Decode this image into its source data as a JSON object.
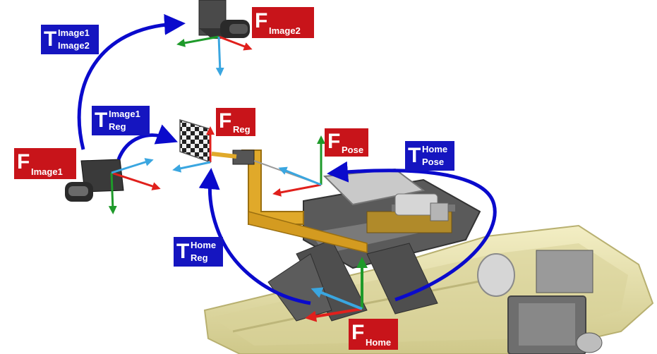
{
  "colors": {
    "frame_label_bg": "#c8141a",
    "transform_label_bg": "#1515c0",
    "axis_x": "#e0201c",
    "axis_y": "#1e9a2a",
    "axis_z": "#3aa6e0",
    "transform_arrow": "#0a0acc",
    "robot_base": "#e9e3a8",
    "robot_arm": "#e0a92a",
    "metal": "#8a8a8a"
  },
  "frames": {
    "image2": {
      "symbol": "F",
      "sub": "Image2"
    },
    "image1": {
      "symbol": "F",
      "sub": "Image1"
    },
    "reg": {
      "symbol": "F",
      "sub": "Reg"
    },
    "pose": {
      "symbol": "F",
      "sub": "Pose"
    },
    "home": {
      "symbol": "F",
      "sub": "Home"
    }
  },
  "transforms": {
    "image1_image2": {
      "symbol": "T",
      "sup": "Image1",
      "sub": "Image2"
    },
    "image1_reg": {
      "symbol": "T",
      "sup": "Image1",
      "sub": "Reg"
    },
    "home_pose": {
      "symbol": "T",
      "sup": "Home",
      "sub": "Pose"
    },
    "home_reg": {
      "symbol": "T",
      "sup": "Home",
      "sub": "Reg"
    }
  }
}
